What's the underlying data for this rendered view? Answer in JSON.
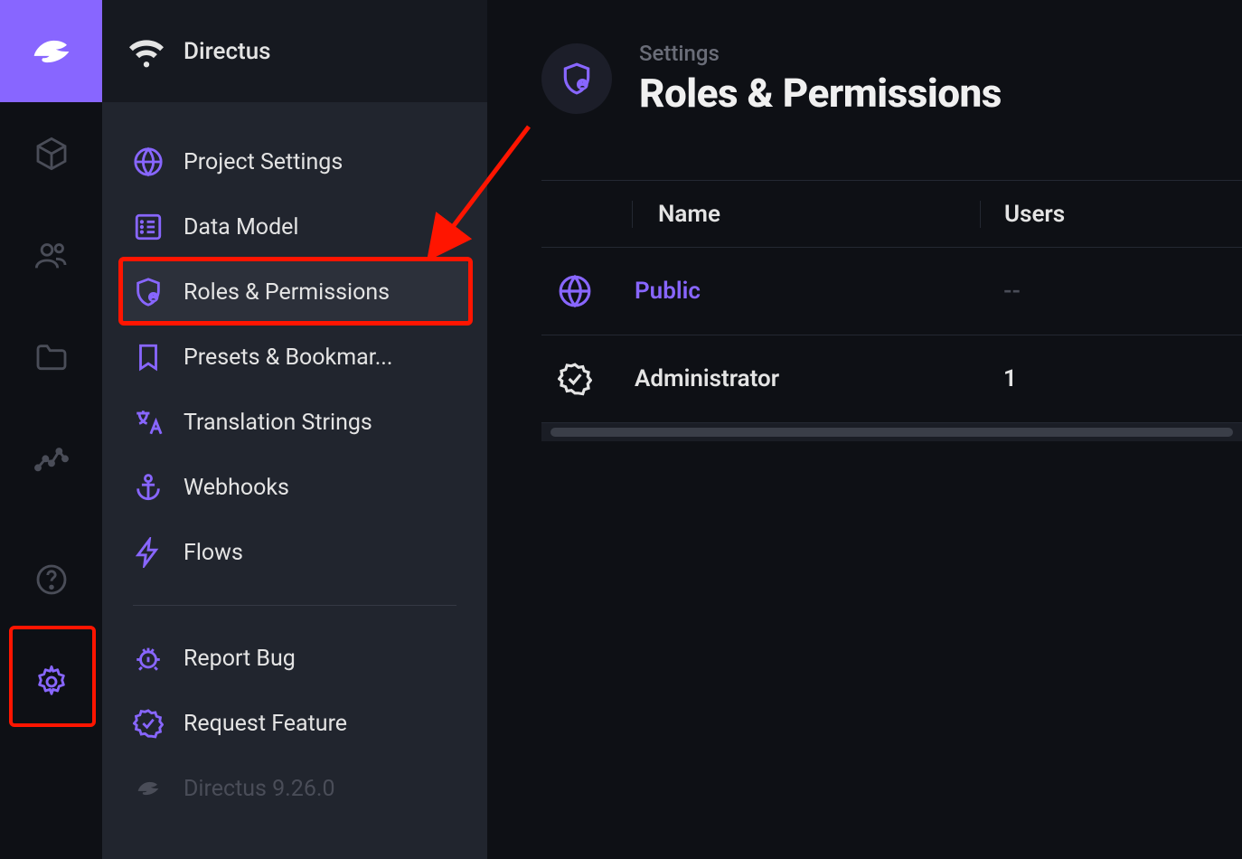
{
  "brand": {
    "name": "Directus"
  },
  "sidebar": {
    "header_title": "Directus",
    "items": [
      {
        "label": "Project Settings"
      },
      {
        "label": "Data Model"
      },
      {
        "label": "Roles & Permissions"
      },
      {
        "label": "Presets & Bookmar..."
      },
      {
        "label": "Translation Strings"
      },
      {
        "label": "Webhooks"
      },
      {
        "label": "Flows"
      }
    ],
    "extras": [
      {
        "label": "Report Bug"
      },
      {
        "label": "Request Feature"
      }
    ],
    "version": "Directus 9.26.0"
  },
  "page": {
    "breadcrumb": "Settings",
    "title": "Roles & Permissions"
  },
  "table": {
    "headers": {
      "name": "Name",
      "users": "Users"
    },
    "rows": [
      {
        "name": "Public",
        "users": "--",
        "public": true
      },
      {
        "name": "Administrator",
        "users": "1",
        "public": false
      }
    ]
  },
  "colors": {
    "accent": "#8866ff",
    "annotation": "#ff1500"
  }
}
